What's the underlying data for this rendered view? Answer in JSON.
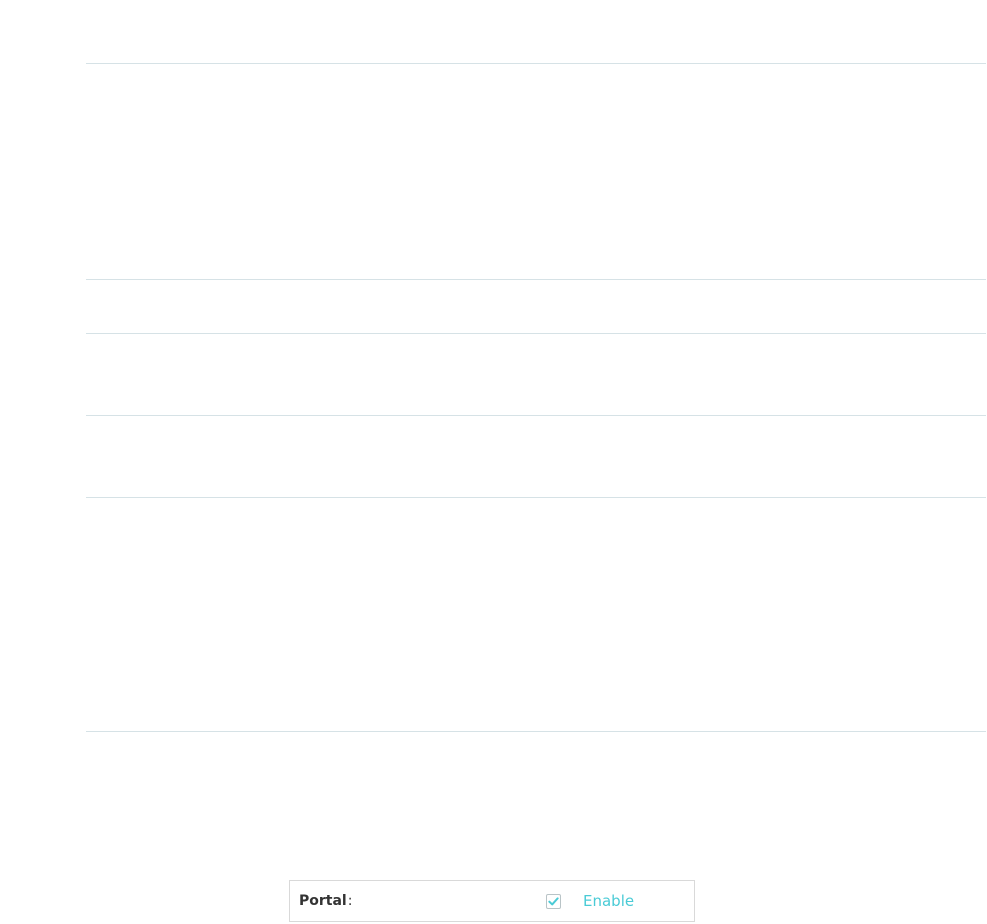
{
  "portal": {
    "label": "Portal",
    "colon": ":",
    "checkbox": {
      "checked": true,
      "label": "Enable",
      "icon": "checkmark-icon",
      "check_color": "#4acbd6"
    }
  },
  "colors": {
    "divider": "#d6e2e6",
    "accent": "#4acbd6",
    "label_text": "#333333"
  }
}
